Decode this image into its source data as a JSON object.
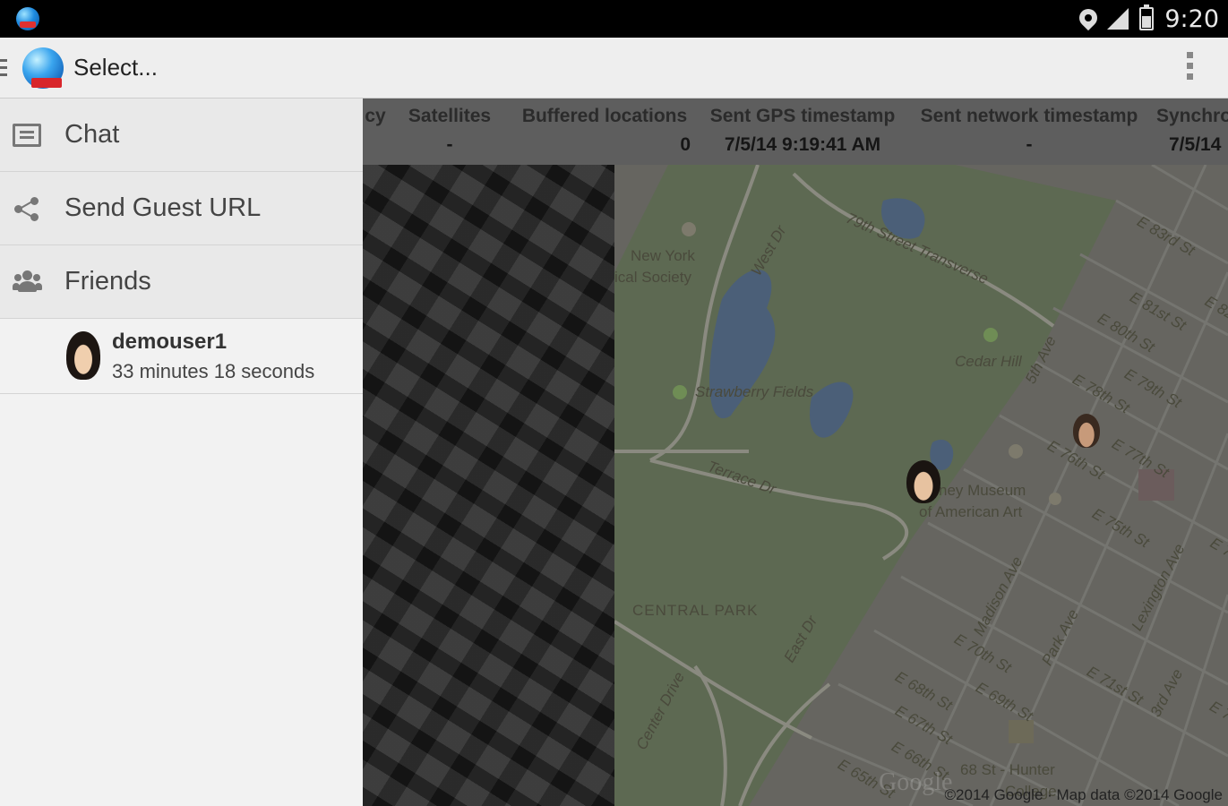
{
  "status_bar": {
    "time": "9:20",
    "icons": [
      "app-globe-icon",
      "location-pin-icon",
      "signal-icon",
      "battery-icon"
    ]
  },
  "action_bar": {
    "title": "Select...",
    "icons": [
      "drawer-indicator-icon",
      "app-logo-icon",
      "overflow-menu-icon"
    ]
  },
  "drawer": {
    "items": [
      {
        "label": "Chat",
        "icon": "chat-icon"
      },
      {
        "label": "Send Guest URL",
        "icon": "share-icon"
      },
      {
        "label": "Friends",
        "icon": "friends-icon"
      }
    ],
    "friends": [
      {
        "name": "demouser1",
        "elapsed": "33 minutes 18 seconds"
      }
    ]
  },
  "stats_bar": {
    "columns": [
      {
        "header": "cy",
        "value": ""
      },
      {
        "header": "Satellites",
        "value": "-"
      },
      {
        "header": "Buffered locations",
        "value": "0"
      },
      {
        "header": "Sent GPS timestamp",
        "value": "7/5/14 9:19:41 AM"
      },
      {
        "header": "Sent network timestamp",
        "value": "-"
      },
      {
        "header": "Synchro",
        "value": "7/5/14"
      }
    ]
  },
  "map": {
    "labels": [
      "New York",
      "ical Society",
      "West Dr",
      "79th Street Transverse",
      "Cedar Hill",
      "Strawberry Fields",
      "Terrace Dr",
      "ney Museum",
      "of American Art",
      "CENTRAL PARK",
      "East Dr",
      "Center Drive",
      "5th Ave",
      "Madison Ave",
      "Park Ave",
      "Lexington Ave",
      "3rd Ave",
      "E 83rd St",
      "E 82",
      "E 81st St",
      "E 80th St",
      "E 79th St",
      "E 78th St",
      "E 77th St",
      "E 76th St",
      "E 75th St",
      "E 74",
      "E 71st St",
      "E 70th St",
      "E 69th St",
      "E 68th St",
      "E 67th St",
      "E 66th St",
      "E 65th St",
      "E 7",
      "68 St - Hunter",
      "College"
    ],
    "watermark": "Google",
    "attribution": "©2014 Google · Map data ©2014 Google"
  }
}
